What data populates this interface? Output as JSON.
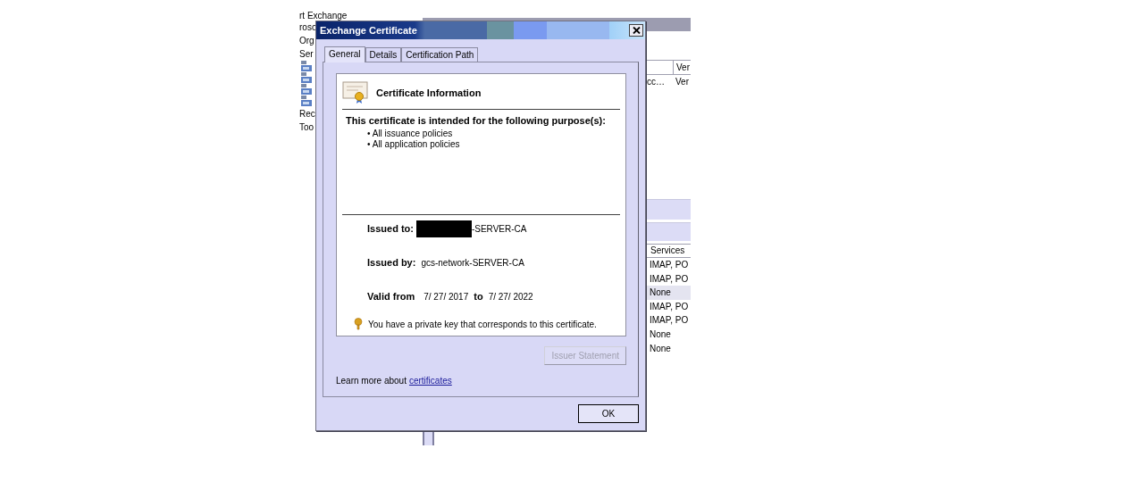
{
  "background_window": {
    "nav_top": [
      "rt Exchange",
      "roso",
      "Org",
      "Ser"
    ],
    "nav_bottom": [
      "Rec",
      "Too"
    ],
    "column_header": "Ver",
    "row": [
      "cc…",
      "Ver"
    ],
    "services_header": "Services",
    "services": [
      {
        "text": "IMAP, PO",
        "selected": false
      },
      {
        "text": "IMAP, PO",
        "selected": false
      },
      {
        "text": "None",
        "selected": true
      },
      {
        "text": "IMAP, PO",
        "selected": false
      },
      {
        "text": "IMAP, PO",
        "selected": false
      },
      {
        "text": "None",
        "selected": false
      },
      {
        "text": "None",
        "selected": false
      }
    ]
  },
  "dialog": {
    "title": "Exchange Certificate",
    "tabs": [
      {
        "label": "General",
        "selected": true
      },
      {
        "label": "Details",
        "selected": false
      },
      {
        "label": "Certification Path",
        "selected": false
      }
    ],
    "info_title": "Certificate Information",
    "purpose_heading": "This certificate is intended for the following purpose(s):",
    "purposes": [
      "• All issuance policies",
      "• All application policies"
    ],
    "issued_to": {
      "label": "Issued to:",
      "value": "-SERVER-CA",
      "redacted": true
    },
    "issued_by": {
      "label": "Issued by:",
      "value": "gcs-network-SERVER-CA"
    },
    "valid": {
      "label": "Valid from",
      "from": "7/ 27/ 2017",
      "to_label": "to",
      "to": "7/ 27/ 2022"
    },
    "key_note": "You have a private key that corresponds to this certificate.",
    "issuer_statement": {
      "label": "Issuer Statement",
      "disabled": true
    },
    "learn_more": "Learn more about",
    "link": "certificates",
    "ok": "OK"
  }
}
